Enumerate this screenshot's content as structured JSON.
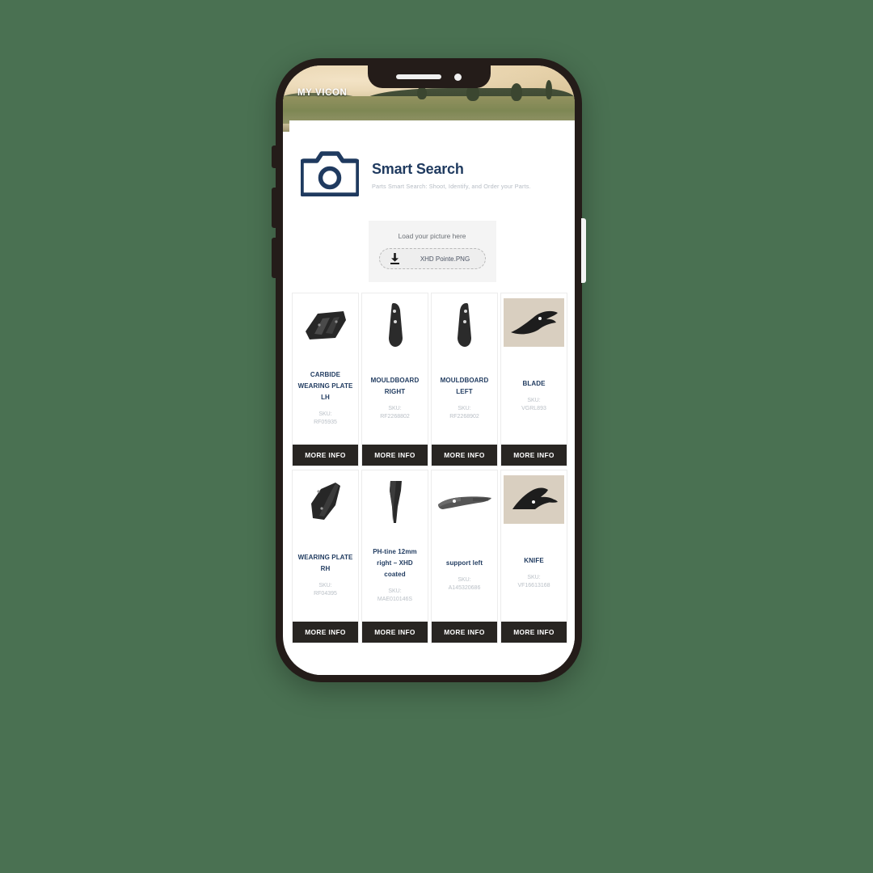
{
  "background_color": "#4a7152",
  "phone": {
    "frame_color": "#241c19",
    "power_button_color": "#f4f4f4"
  },
  "hero": {
    "brand_label": "MY VICON"
  },
  "search_header": {
    "icon": "camera-icon",
    "title": "Smart Search",
    "subtitle": "Parts Smart Search: Shoot, Identify, and Order your Parts."
  },
  "upload": {
    "hint": "Load your picture here",
    "icon": "download-arrow-icon",
    "filename": "XHD Pointe.PNG"
  },
  "cta_label": "MORE INFO",
  "sku_label": "SKU:",
  "colors": {
    "title_navy": "#1f3a5f",
    "sku_grey": "#b9bfc6",
    "cta_dark": "#282522",
    "panel_grey": "#f4f4f4",
    "beige_photo_bg": "#d9cfc0"
  },
  "products": [
    {
      "title": "CARBIDE WEARING PLATE LH",
      "sku_label": "SKU:",
      "sku": "RF05935",
      "cta": "MORE INFO",
      "image_bg": "white",
      "image_name": "carbide-wearing-plate-lh-photo"
    },
    {
      "title": "MOULDBOARD RIGHT",
      "sku_label": "SKU:",
      "sku": "RF2268802",
      "cta": "MORE INFO",
      "image_bg": "white",
      "image_name": "mouldboard-right-photo"
    },
    {
      "title": "MOULDBOARD LEFT",
      "sku_label": "SKU:",
      "sku": "RF2268902",
      "cta": "MORE INFO",
      "image_bg": "white",
      "image_name": "mouldboard-left-photo"
    },
    {
      "title": "BLADE",
      "sku_label": "SKU:",
      "sku": "VGRL893",
      "cta": "MORE INFO",
      "image_bg": "beige",
      "image_name": "blade-photo"
    },
    {
      "title": "WEARING PLATE RH",
      "sku_label": "SKU:",
      "sku": "RF04395",
      "cta": "MORE INFO",
      "image_bg": "white",
      "image_name": "wearing-plate-rh-photo"
    },
    {
      "title": "PH-tine 12mm right – XHD coated",
      "sku_label": "SKU:",
      "sku": "MAE010146S",
      "cta": "MORE INFO",
      "image_bg": "white",
      "image_name": "ph-tine-photo"
    },
    {
      "title": "support left",
      "sku_label": "SKU:",
      "sku": "A145320686",
      "cta": "MORE INFO",
      "image_bg": "white",
      "image_name": "support-left-photo"
    },
    {
      "title": "KNIFE",
      "sku_label": "SKU:",
      "sku": "VF16613168",
      "cta": "MORE INFO",
      "image_bg": "beige",
      "image_name": "knife-photo"
    }
  ]
}
